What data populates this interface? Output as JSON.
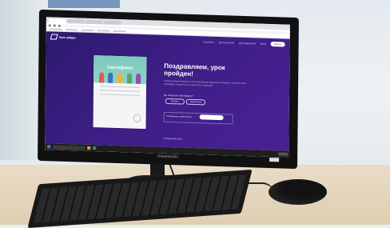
{
  "monitor": {
    "brand": "ViewSonic"
  },
  "site": {
    "logo": "Урок цифры",
    "nav": [
      "О проекте",
      "Для учителей",
      "Для родителей",
      "Вход"
    ],
    "nav_button": "Начать"
  },
  "certificate": {
    "title": "Сертификат"
  },
  "content": {
    "headline": "Поздравляем, урок пройден!",
    "subtext": "Теперь вы знаете больше о том, как работают цифровые технологии. Получите свой сертификат и поделитесь результатом с друзьями!",
    "question": "Вы получили сертификат?",
    "choice_1": "Скачать",
    "choice_2": "Поделиться",
    "panel_text": "Расскажите о своём опыте",
    "footer": "Следующий урок"
  },
  "colors": {
    "page_bg": "#3d1e86",
    "accent": "#7ec8c1"
  }
}
